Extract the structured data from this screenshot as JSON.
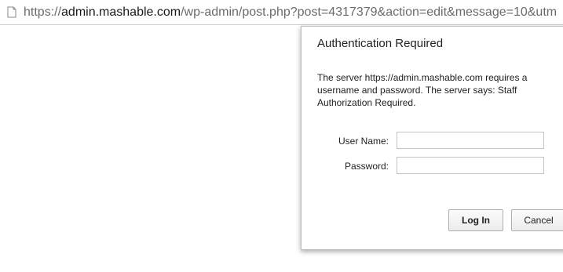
{
  "browser": {
    "url_prefix": "https://",
    "url_host": "admin.mashable.com",
    "url_rest": "/wp-admin/post.php?post=4317379&action=edit&message=10&utm",
    "page_icon": "page-icon"
  },
  "dialog": {
    "title": "Authentication Required",
    "message": "The server https://admin.mashable.com requires a username and password. The server says: Staff Authorization Required.",
    "username_label": "User Name:",
    "username_value": "",
    "password_label": "Password:",
    "password_value": "",
    "login_button": "Log In",
    "cancel_button": "Cancel"
  }
}
